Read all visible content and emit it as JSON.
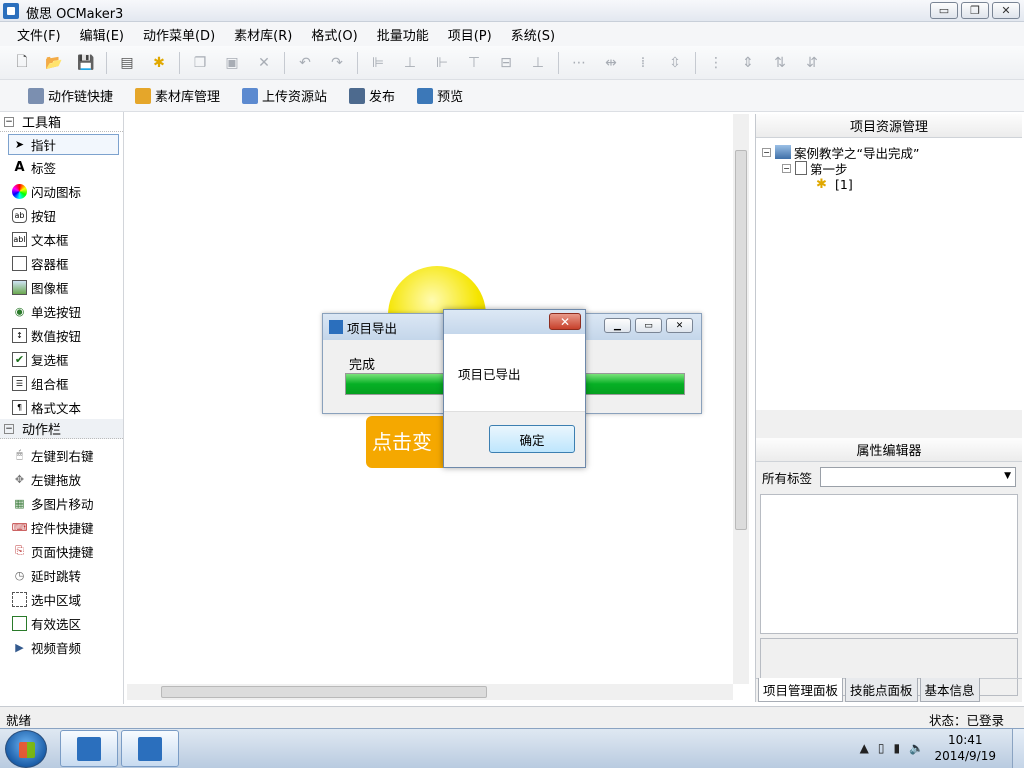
{
  "window": {
    "title": "傲思 OCMaker3",
    "minimize": "▭",
    "restore": "❐",
    "close": "✕"
  },
  "menu": [
    "文件(F)",
    "编辑(E)",
    "动作菜单(D)",
    "素材库(R)",
    "格式(O)",
    "批量功能",
    "项目(P)",
    "系统(S)"
  ],
  "toolbar": {
    "icons": [
      "new-icon",
      "open-icon",
      "save-icon",
      "page-icon",
      "puzzle-icon",
      "copy-icon",
      "paste-icon",
      "delete-icon",
      "undo-icon",
      "redo-icon",
      "align-left-icon",
      "align-center-icon",
      "align-right-icon",
      "align-top-icon",
      "align-middle-icon",
      "align-bottom-icon",
      "distribute-h-icon",
      "space-h-icon",
      "space-h2-icon",
      "space-v-icon",
      "distribute-v-icon",
      "space-v2-icon",
      "space-v3-icon",
      "space-v4-icon"
    ]
  },
  "toolbar2": [
    {
      "label": "动作链快捷",
      "icon": "action-chain-icon"
    },
    {
      "label": "素材库管理",
      "icon": "library-icon"
    },
    {
      "label": "上传资源站",
      "icon": "upload-icon"
    },
    {
      "label": "发布",
      "icon": "publish-icon"
    },
    {
      "label": "预览",
      "icon": "preview-icon"
    }
  ],
  "toolbox": {
    "group1": "工具箱",
    "tools": [
      "指针",
      "标签",
      "闪动图标",
      "按钮",
      "文本框",
      "容器框",
      "图像框",
      "单选按钮",
      "数值按钮",
      "复选框",
      "组合框",
      "格式文本"
    ],
    "group2": "动作栏",
    "actions": [
      "左键到右键",
      "左键拖放",
      "多图片移动",
      "控件快捷键",
      "页面快捷键",
      "延时跳转",
      "选中区域",
      "有效选区",
      "视频音频"
    ]
  },
  "canvas": {
    "button_text": "点击变"
  },
  "export_window": {
    "title": "项目导出",
    "status": "完成",
    "progress": 1.0
  },
  "message_box": {
    "close": "✕",
    "text": "项目已导出",
    "ok_label": "确定"
  },
  "project_panel": {
    "title": "项目资源管理",
    "tree": [
      {
        "label": "案例教学之“导出完成”",
        "level": 0
      },
      {
        "label": "第一步",
        "level": 1
      },
      {
        "label": "[1]",
        "level": 2
      }
    ]
  },
  "property_panel": {
    "title": "属性编辑器",
    "tag_label": "所有标签",
    "tag_value": ""
  },
  "tabs": [
    "项目管理面板",
    "技能点面板",
    "基本信息"
  ],
  "status": {
    "left": "就绪",
    "right": "状态：已登录"
  },
  "taskbar": {
    "time": "10:41",
    "date": "2014/9/19"
  }
}
